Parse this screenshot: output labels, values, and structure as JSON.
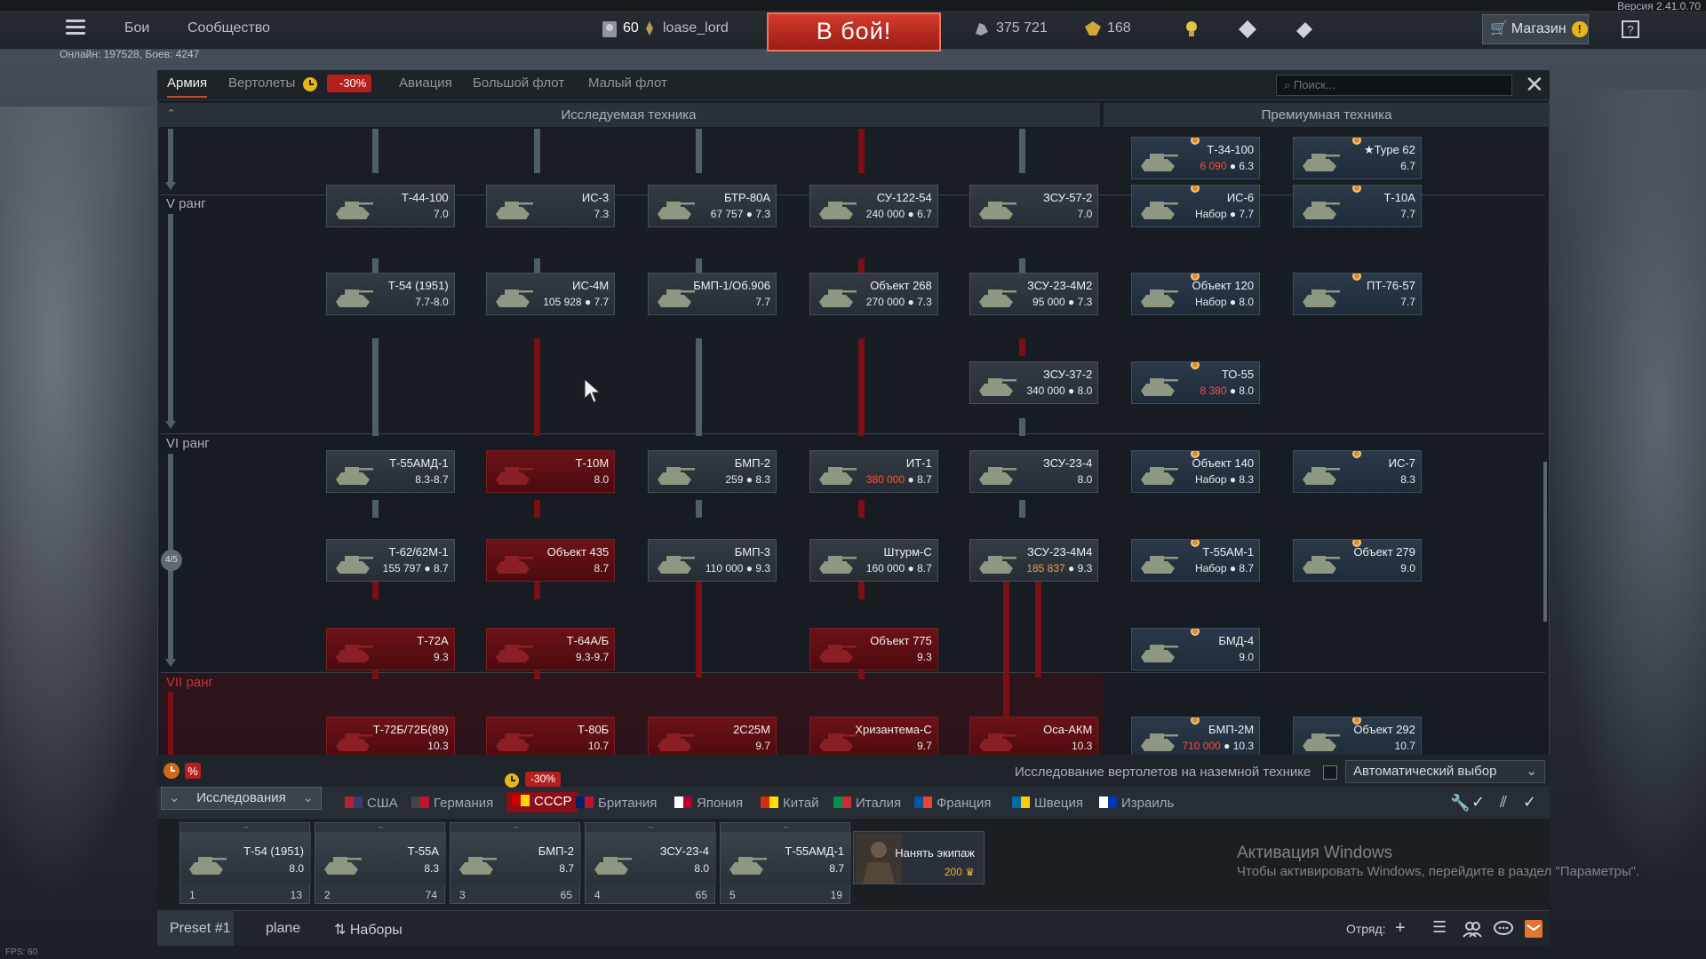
{
  "app": {
    "version": "Версия 2.41.0.70",
    "fps": "FPS: 60",
    "online": "Онлайн: 197528, Боев: 4247"
  },
  "topbar": {
    "battles": "Бои",
    "community": "Сообщество",
    "level": "60",
    "username": "loase_lord",
    "to_battle": "В бой!",
    "silver": "375 721",
    "gold": "168",
    "shop": "Магазин"
  },
  "tabs": [
    {
      "label": "Армия"
    },
    {
      "label": "Вертолеты"
    },
    {
      "label": "Авиация"
    },
    {
      "label": "Большой флот"
    },
    {
      "label": "Малый флот"
    }
  ],
  "tab_discount": "-30%",
  "search": {
    "placeholder": "Поиск..."
  },
  "headers": {
    "researched": "Исследуемая техника",
    "premium": "Премиумная техника"
  },
  "ranks": {
    "r5": "V ранг",
    "r6": "VI ранг",
    "r7": "VII ранг",
    "progress": "4/5"
  },
  "vehicles": {
    "c1": [
      {
        "name": "Т-44-100",
        "br": "7.0"
      },
      {
        "name": "Т-54 (1951)",
        "br": "7.7-8.0"
      },
      {
        "name": "Т-55АМД-1",
        "br": "8.3-8.7"
      },
      {
        "name": "Т-62/62М-1",
        "cost": "155 797",
        "br": "8.7"
      },
      {
        "name": "Т-72А",
        "br": "9.3"
      },
      {
        "name": "Т-72Б/72Б(89)",
        "br": "10.3"
      }
    ],
    "c2": [
      {
        "name": "ИС-3",
        "br": "7.3"
      },
      {
        "name": "ИС-4М",
        "cost": "105 928",
        "br": "7.7"
      },
      {
        "name": "Т-10М",
        "br": "8.0"
      },
      {
        "name": "Объект 435",
        "br": "8.7"
      },
      {
        "name": "Т-64А/Б",
        "br": "9.3-9.7"
      },
      {
        "name": "Т-80Б",
        "br": "10.7"
      }
    ],
    "c3": [
      {
        "name": "БТР-80А",
        "cost": "67 757",
        "br": "7.3"
      },
      {
        "name": "БМП-1/Об.906",
        "br": "7.7"
      },
      {
        "name": "БМП-2",
        "cost": "259",
        "br": "8.3"
      },
      {
        "name": "БМП-3",
        "cost": "110 000",
        "br": "9.3"
      },
      {
        "name": "2С25М",
        "br": "9.7"
      }
    ],
    "c4": [
      {
        "name": "СУ-122-54",
        "cost": "240 000",
        "br": "6.7"
      },
      {
        "name": "Объект 268",
        "cost": "270 000",
        "br": "7.3"
      },
      {
        "name": "ИТ-1",
        "cost": "380 000",
        "br": "8.7"
      },
      {
        "name": "Штурм-С",
        "cost": "160 000",
        "br": "8.7"
      },
      {
        "name": "Объект 775",
        "br": "9.3"
      },
      {
        "name": "Хризантема-С",
        "br": "9.7"
      }
    ],
    "c5": [
      {
        "name": "ЗСУ-57-2",
        "br": "7.0"
      },
      {
        "name": "ЗСУ-23-4М2",
        "cost": "95 000",
        "br": "7.3"
      },
      {
        "name": "ЗСУ-37-2",
        "cost": "340 000",
        "br": "8.0"
      },
      {
        "name": "ЗСУ-23-4",
        "br": "8.0"
      },
      {
        "name": "ЗСУ-23-4М4",
        "cost": "185 837",
        "br": "9.3"
      },
      {
        "name": "Оса-АКМ",
        "br": "10.3"
      }
    ],
    "p1": [
      {
        "name": "Т-34-100",
        "cost": "6 090",
        "br": "6.3"
      },
      {
        "name": "ИС-6",
        "cost": "Набор",
        "br": "7.7"
      },
      {
        "name": "Объект 120",
        "cost": "Набор",
        "br": "8.0"
      },
      {
        "name": "ТО-55",
        "cost": "8 380",
        "br": "8.0"
      },
      {
        "name": "Объект 140",
        "cost": "Набор",
        "br": "8.3"
      },
      {
        "name": "Т-55АМ-1",
        "cost": "Набор",
        "br": "8.7"
      },
      {
        "name": "БМД-4",
        "br": "9.0"
      },
      {
        "name": "БМП-2М",
        "cost": "710 000",
        "br": "10.3"
      }
    ],
    "p2": [
      {
        "name": "★Type 62",
        "br": "6.7"
      },
      {
        "name": "Т-10А",
        "br": "7.7"
      },
      {
        "name": "ПТ-76-57",
        "br": "7.7"
      },
      {
        "name": "ИС-7",
        "br": "8.3"
      },
      {
        "name": "Объект 279",
        "br": "9.0"
      },
      {
        "name": "Объект 292",
        "br": "10.7"
      }
    ]
  },
  "bottom": {
    "heli_research": "Исследование вертолетов на наземной технике",
    "auto_select": "Автоматический выбор",
    "research_btn": "Исследования",
    "nation_discount": "-30%"
  },
  "nations": [
    {
      "label": "США",
      "flag": "usa"
    },
    {
      "label": "Германия",
      "flag": "germany"
    },
    {
      "label": "СССР",
      "flag": "ussr"
    },
    {
      "label": "Британия",
      "flag": "britain"
    },
    {
      "label": "Япония",
      "flag": "japan"
    },
    {
      "label": "Китай",
      "flag": "china"
    },
    {
      "label": "Италия",
      "flag": "italy"
    },
    {
      "label": "Франция",
      "flag": "france"
    },
    {
      "label": "Швеция",
      "flag": "sweden"
    },
    {
      "label": "Израиль",
      "flag": "israel"
    }
  ],
  "crew": [
    {
      "name": "Т-54 (1951)",
      "br": "8.0",
      "num": "1",
      "count": "13"
    },
    {
      "name": "Т-55А",
      "br": "8.3",
      "num": "2",
      "count": "74"
    },
    {
      "name": "БМП-2",
      "br": "8.7",
      "num": "3",
      "count": "65"
    },
    {
      "name": "ЗСУ-23-4",
      "br": "8.0",
      "num": "4",
      "count": "65"
    },
    {
      "name": "Т-55АМД-1",
      "br": "8.7",
      "num": "5",
      "count": "19"
    }
  ],
  "hire": {
    "label": "Нанять экипаж",
    "cost": "200"
  },
  "windows": {
    "title": "Активация Windows",
    "text": "Чтобы активировать Windows, перейдите в раздел \"Параметры\"."
  },
  "footer": {
    "preset": "Preset #1",
    "plane": "plane",
    "sets": "Наборы",
    "squad": "Отряд:"
  }
}
